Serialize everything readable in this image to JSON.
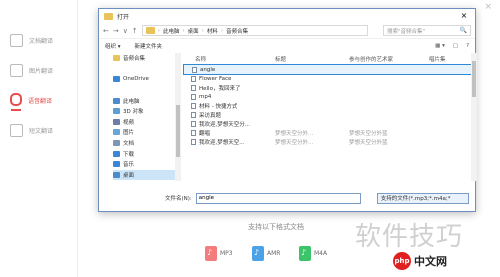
{
  "app": {
    "close_icon": "×",
    "sidebar": [
      {
        "label": "文档翻译",
        "active": false
      },
      {
        "label": "图片翻译",
        "active": false
      },
      {
        "label": "语音翻译",
        "active": true
      },
      {
        "label": "短文翻译",
        "active": false
      }
    ],
    "formats_title": "支持以下格式文档",
    "formats": [
      {
        "label": "MP3",
        "color": "#f47c7c"
      },
      {
        "label": "AMR",
        "color": "#4aa3e8"
      },
      {
        "label": "M4A",
        "color": "#3cc46b"
      }
    ]
  },
  "dialog": {
    "title": "打开",
    "close": "×",
    "nav": {
      "back": "←",
      "forward": "→",
      "dropdown": "∨",
      "up": "↑"
    },
    "breadcrumb": [
      "此电脑",
      "桌面",
      "材料",
      "音频合集"
    ],
    "search_placeholder": "搜索\"音频合集\"",
    "search_icon": "🔍",
    "toolbar": {
      "organize": "组织 ▾",
      "new_folder": "新建文件夹",
      "view": "▦ ▾",
      "pane": "▢",
      "help": "?"
    },
    "nav_items": [
      {
        "label": "音频合集",
        "color": "#e8c35a",
        "selected": false
      },
      {
        "label": "",
        "color": "transparent",
        "selected": false
      },
      {
        "label": "OneDrive",
        "color": "#3a87d8",
        "selected": false
      },
      {
        "label": "",
        "color": "transparent",
        "selected": false
      },
      {
        "label": "此电脑",
        "color": "#4a8ccc",
        "selected": false
      },
      {
        "label": "3D 对象",
        "color": "#5aa0d6",
        "selected": false
      },
      {
        "label": "视频",
        "color": "#6a7ea8",
        "selected": false
      },
      {
        "label": "图片",
        "color": "#6aa6d6",
        "selected": false
      },
      {
        "label": "文档",
        "color": "#7f96b5",
        "selected": false
      },
      {
        "label": "下载",
        "color": "#3a87d8",
        "selected": false
      },
      {
        "label": "音乐",
        "color": "#3a87d8",
        "selected": false
      },
      {
        "label": "桌面",
        "color": "#4a8ccc",
        "selected": true
      }
    ],
    "columns": {
      "name": "名称",
      "title": "标题",
      "artist": "参与创作的艺术家",
      "album": "唱片集"
    },
    "files": [
      {
        "name": "angle",
        "title": "",
        "artist": "",
        "album": "",
        "highlight": true
      },
      {
        "name": "Flower Face",
        "title": "",
        "artist": "",
        "album": "",
        "highlight": false
      },
      {
        "name": "Hello，我回来了",
        "title": "",
        "artist": "",
        "album": "",
        "highlight": false
      },
      {
        "name": "mp4",
        "title": "",
        "artist": "",
        "album": "",
        "highlight": false
      },
      {
        "name": "材料 - 快捷方式",
        "title": "",
        "artist": "",
        "album": "",
        "highlight": false
      },
      {
        "name": "采访真题",
        "title": "",
        "artist": "",
        "album": "",
        "highlight": false
      },
      {
        "name": "我欢迎,梦想天空分...",
        "title": "",
        "artist": "",
        "album": "",
        "highlight": false
      },
      {
        "name": "翻唱",
        "title": "梦想天空分外...",
        "artist": "梦想天空分外蓝",
        "album": "",
        "highlight": false
      },
      {
        "name": "我欢迎,梦想天空...",
        "title": "梦想天空分外...",
        "artist": "梦想天空分外蓝",
        "album": "",
        "highlight": false
      }
    ],
    "filename_label": "文件名(N):",
    "filename_value": "angle",
    "filetype": "支持的文件(*.mp3;*.m4a;*"
  },
  "watermark": {
    "big": "软件技巧",
    "logo": "php",
    "small": "中文网"
  }
}
